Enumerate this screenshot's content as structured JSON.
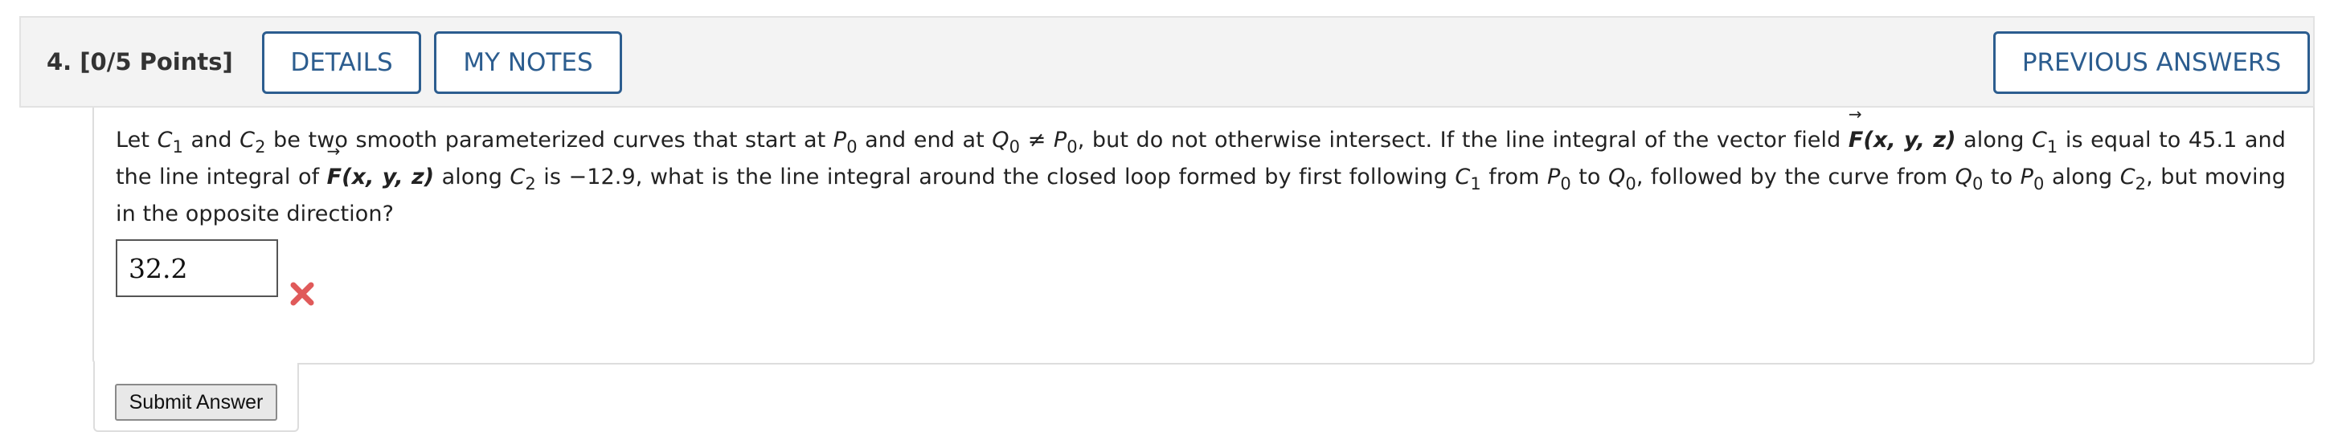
{
  "question": {
    "number_label": "4. [0/5 Points]",
    "details_label": "DETAILS",
    "notes_label": "MY NOTES",
    "previous_answers_label": "PREVIOUS ANSWERS"
  },
  "text": {
    "t1": "Let ",
    "c": "C",
    "one": "1",
    "two": "2",
    "zero": "0",
    "p": "P",
    "q": "Q",
    "F": "F",
    "args": "(x, y, z)",
    "t2": " and ",
    "t3": " be two smooth parameterized curves that start at ",
    "t4": " and end at ",
    "t5": " ≠ ",
    "t6": ", but do not otherwise intersect. If the line integral of the vector field ",
    "t7": " along ",
    "t8": " is equal to 45.1 and the line integral of ",
    "t9": " along ",
    "t10": " is −12.9, what is the line integral around the closed loop formed by first following ",
    "t11": " from ",
    "t12": " to ",
    "t13": ", followed by the curve from ",
    "t14": " to ",
    "t15": " along ",
    "t16": ", but moving in the opposite direction?"
  },
  "answer": {
    "value": "32.2",
    "status": "incorrect",
    "status_icon": "x-mark-icon",
    "status_color": "#e05a5a"
  },
  "submit_label": "Submit Answer",
  "colors": {
    "accent": "#2c5d8f",
    "header_bg": "#f3f3f3"
  }
}
